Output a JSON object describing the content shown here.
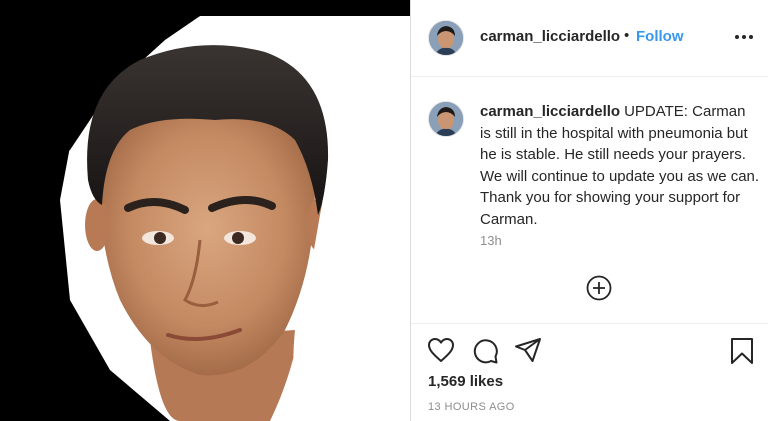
{
  "post": {
    "username": "carman_licciardello",
    "follow_separator": "•",
    "follow_label": "Follow",
    "caption_text": "UPDATE: Carman is still in the hospital with pneumonia but he is stable. He still needs your prayers. We will continue to update you as we can. Thank you for showing your support for Carman.",
    "caption_time": "13h",
    "likes": "1,569 likes",
    "posted_ago": "13 HOURS AGO"
  },
  "icons": {
    "more": "more-options-icon",
    "load_more": "add-circle-icon",
    "like": "heart-icon",
    "comment": "comment-icon",
    "share": "paper-plane-icon",
    "save": "bookmark-icon"
  },
  "colors": {
    "follow": "#3897f0",
    "text": "#262626",
    "muted": "#8e8e8e",
    "border": "#dbdbdb"
  }
}
